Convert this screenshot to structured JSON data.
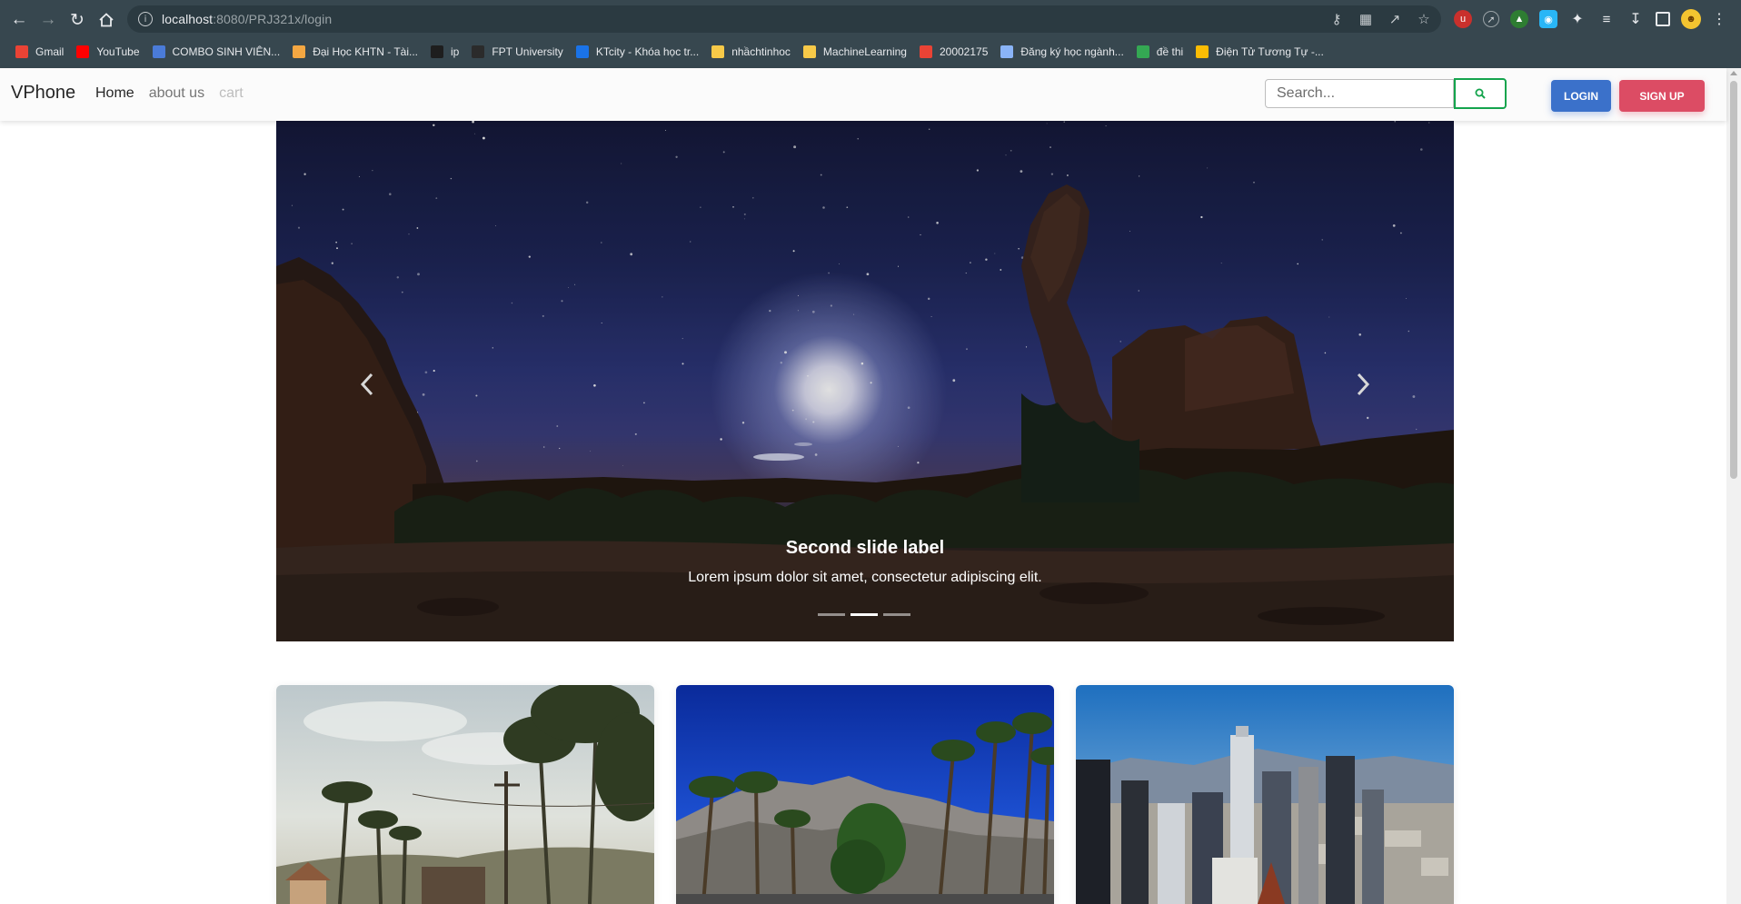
{
  "browser": {
    "url_host": "localhost",
    "url_rest": ":8080/PRJ321x/login",
    "bookmarks": [
      {
        "label": "Gmail",
        "icon": "gmail-icon",
        "color": "#ea4335"
      },
      {
        "label": "YouTube",
        "icon": "youtube-icon",
        "color": "#ff0000"
      },
      {
        "label": "COMBO SINH VIÊN...",
        "icon": "group-icon",
        "color": "#4a7bd8"
      },
      {
        "label": "Đại Học KHTN - Tài...",
        "icon": "document-icon",
        "color": "#f4a742"
      },
      {
        "label": "ip",
        "icon": "ip-icon",
        "color": "#1e1e1e"
      },
      {
        "label": "FPT University",
        "icon": "fpt-icon",
        "color": "#2b2b2b"
      },
      {
        "label": "KTcity - Khóa học tr...",
        "icon": "ktcity-icon",
        "color": "#1a73e8"
      },
      {
        "label": "nhầchtinhoc",
        "icon": "folder-icon",
        "color": "#f7c948"
      },
      {
        "label": "MachineLearning",
        "icon": "folder-icon",
        "color": "#f7c948"
      },
      {
        "label": "20002175",
        "icon": "gmail-icon",
        "color": "#ea4335"
      },
      {
        "label": "Đăng ký học ngành...",
        "icon": "globe-icon",
        "color": "#8ab4f8"
      },
      {
        "label": "đề thi",
        "icon": "classroom-icon",
        "color": "#34a853"
      },
      {
        "label": "Điện Tử Tương Tự -...",
        "icon": "drive-icon",
        "color": "#fbbc04"
      }
    ]
  },
  "navbar": {
    "brand": "VPhone",
    "links": {
      "home": "Home",
      "about": "about us",
      "cart": "cart"
    },
    "search_placeholder": "Search...",
    "login": "LOGIN",
    "signup": "SIGN UP"
  },
  "carousel": {
    "title": "Second slide label",
    "text": "Lorem ipsum dolor sit amet, consectetur adipiscing elit.",
    "slide_count": 3,
    "active_slide": 2
  },
  "cards": [
    {
      "image": "hollywood-palm-street-photo"
    },
    {
      "image": "palm-springs-mountain-photo"
    },
    {
      "image": "los-angeles-skyline-photo"
    }
  ],
  "colors": {
    "primary": "#3b71ca",
    "danger": "#dc4c64",
    "success": "#14a44d",
    "chrome": "#37474f"
  }
}
